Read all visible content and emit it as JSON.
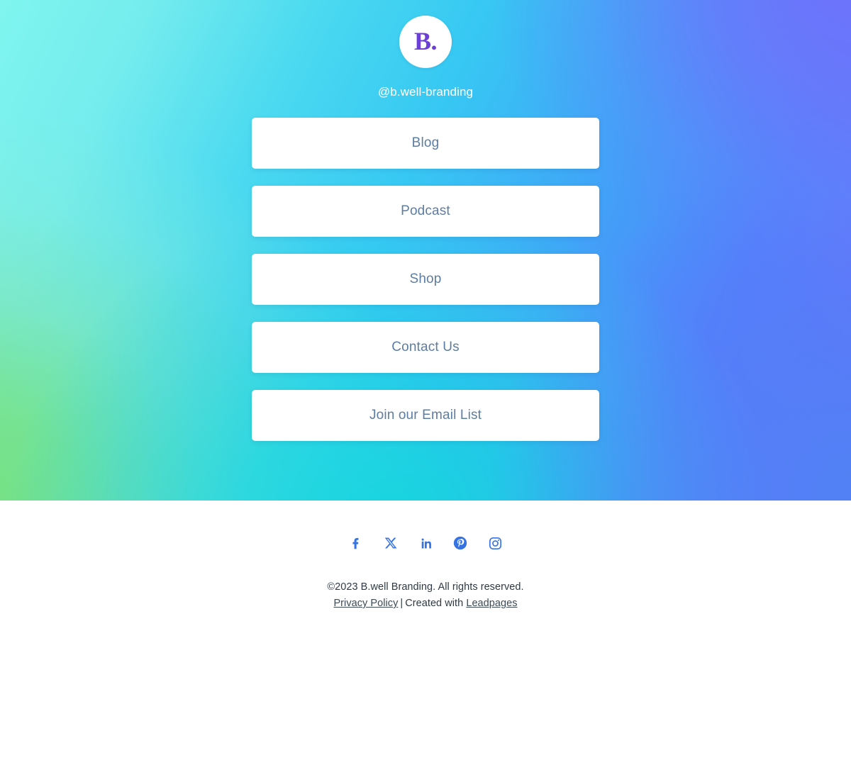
{
  "profile": {
    "avatar_mark": "B.",
    "handle": "@b.well-branding",
    "avatar_text_color": "#6c3fd6",
    "handle_color": "#ffffff"
  },
  "background": {
    "gradient_top_left": "#80f5ef",
    "gradient_top_right": "#6e72fb",
    "gradient_bottom_left": "#76e07c",
    "gradient_bottom_center": "#14d8dc",
    "gradient_bottom_right": "#4d84f3"
  },
  "links": [
    {
      "label": "Blog"
    },
    {
      "label": "Podcast"
    },
    {
      "label": "Shop"
    },
    {
      "label": "Contact Us"
    },
    {
      "label": "Join our Email List"
    }
  ],
  "link_style": {
    "background": "#ffffff",
    "text_color": "#5c7da4"
  },
  "footer": {
    "social": [
      {
        "name": "facebook-icon",
        "label": "Facebook"
      },
      {
        "name": "x-icon",
        "label": "X"
      },
      {
        "name": "linkedin-icon",
        "label": "LinkedIn"
      },
      {
        "name": "pinterest-icon",
        "label": "Pinterest"
      },
      {
        "name": "instagram-icon",
        "label": "Instagram"
      }
    ],
    "social_color": "#3573e2",
    "copyright": "©2023 B.well Branding. All rights reserved.",
    "privacy_policy_label": "Privacy Policy",
    "separator": "|",
    "created_with_label": "Created with",
    "builder_label": "Leadpages"
  }
}
